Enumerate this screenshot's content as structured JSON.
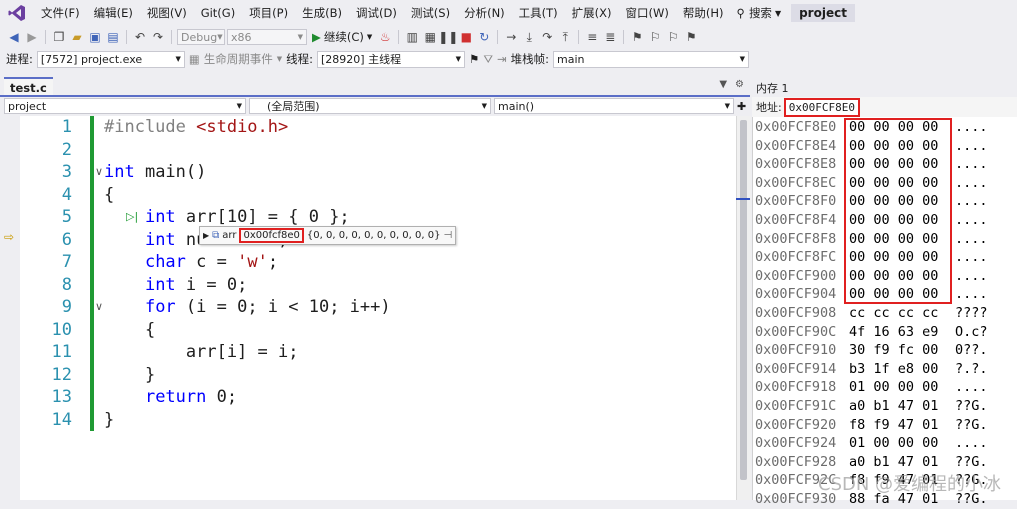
{
  "menubar": {
    "items": [
      "文件(F)",
      "编辑(E)",
      "视图(V)",
      "Git(G)",
      "项目(P)",
      "生成(B)",
      "调试(D)",
      "测试(S)",
      "分析(N)",
      "工具(T)",
      "扩展(X)",
      "窗口(W)",
      "帮助(H)"
    ],
    "search_label": "搜索",
    "title": "project"
  },
  "toolbar1": {
    "config": "Debug",
    "platform": "x86",
    "continue_label": "继续(C)"
  },
  "toolbar2": {
    "process_label": "进程:",
    "process_value": "[7572] project.exe",
    "lifecycle_label": "生命周期事件",
    "thread_label": "线程:",
    "thread_value": "[28920] 主线程",
    "stack_label": "堆栈帧:",
    "stack_value": "main"
  },
  "editor": {
    "tab_name": "test.c",
    "nav_project": "project",
    "nav_scope": "(全局范围)",
    "nav_function": "main()",
    "lines": [
      {
        "num": "1",
        "tokens": [
          {
            "t": "#include ",
            "c": "pp"
          },
          {
            "t": "<stdio.h>",
            "c": "str"
          }
        ]
      },
      {
        "num": "2",
        "tokens": []
      },
      {
        "num": "3",
        "tokens": [
          {
            "t": "int",
            "c": "kw"
          },
          {
            "t": " main()",
            "c": ""
          }
        ]
      },
      {
        "num": "4",
        "tokens": [
          {
            "t": "{",
            "c": ""
          }
        ]
      },
      {
        "num": "5",
        "tokens": [
          {
            "t": "    ",
            "c": ""
          },
          {
            "t": "int",
            "c": "kw"
          },
          {
            "t": " arr[10] = { 0 };",
            "c": ""
          }
        ]
      },
      {
        "num": "6",
        "tokens": [
          {
            "t": "    ",
            "c": ""
          },
          {
            "t": "int",
            "c": "kw"
          },
          {
            "t": " num = 100;",
            "c": ""
          }
        ]
      },
      {
        "num": "7",
        "tokens": [
          {
            "t": "    ",
            "c": ""
          },
          {
            "t": "char",
            "c": "kw"
          },
          {
            "t": " c = ",
            "c": ""
          },
          {
            "t": "'w'",
            "c": "str"
          },
          {
            "t": ";",
            "c": ""
          }
        ]
      },
      {
        "num": "8",
        "tokens": [
          {
            "t": "    ",
            "c": ""
          },
          {
            "t": "int",
            "c": "kw"
          },
          {
            "t": " i = 0;",
            "c": ""
          }
        ]
      },
      {
        "num": "9",
        "tokens": [
          {
            "t": "    ",
            "c": ""
          },
          {
            "t": "for",
            "c": "kw"
          },
          {
            "t": " (i = 0; i < 10; i++)",
            "c": ""
          }
        ]
      },
      {
        "num": "10",
        "tokens": [
          {
            "t": "    {",
            "c": ""
          }
        ]
      },
      {
        "num": "11",
        "tokens": [
          {
            "t": "        arr[i] = i;",
            "c": ""
          }
        ]
      },
      {
        "num": "12",
        "tokens": [
          {
            "t": "    }",
            "c": ""
          }
        ]
      },
      {
        "num": "13",
        "tokens": [
          {
            "t": "    ",
            "c": ""
          },
          {
            "t": "return",
            "c": "kw"
          },
          {
            "t": " 0;",
            "c": ""
          }
        ]
      },
      {
        "num": "14",
        "tokens": [
          {
            "t": "}",
            "c": ""
          }
        ]
      }
    ]
  },
  "datatip": {
    "name": "arr",
    "address": "0x00fcf8e0",
    "value": "{0, 0, 0, 0, 0, 0, 0, 0, 0, 0}"
  },
  "memory": {
    "title": "内存 1",
    "address_label": "地址:",
    "address_value": "0x00FCF8E0",
    "rows": [
      {
        "addr": "0x00FCF8E0",
        "bytes": "00 00 00 00",
        "ascii": "...."
      },
      {
        "addr": "0x00FCF8E4",
        "bytes": "00 00 00 00",
        "ascii": "...."
      },
      {
        "addr": "0x00FCF8E8",
        "bytes": "00 00 00 00",
        "ascii": "...."
      },
      {
        "addr": "0x00FCF8EC",
        "bytes": "00 00 00 00",
        "ascii": "...."
      },
      {
        "addr": "0x00FCF8F0",
        "bytes": "00 00 00 00",
        "ascii": "...."
      },
      {
        "addr": "0x00FCF8F4",
        "bytes": "00 00 00 00",
        "ascii": "...."
      },
      {
        "addr": "0x00FCF8F8",
        "bytes": "00 00 00 00",
        "ascii": "...."
      },
      {
        "addr": "0x00FCF8FC",
        "bytes": "00 00 00 00",
        "ascii": "...."
      },
      {
        "addr": "0x00FCF900",
        "bytes": "00 00 00 00",
        "ascii": "...."
      },
      {
        "addr": "0x00FCF904",
        "bytes": "00 00 00 00",
        "ascii": "...."
      },
      {
        "addr": "0x00FCF908",
        "bytes": "cc cc cc cc",
        "ascii": "????"
      },
      {
        "addr": "0x00FCF90C",
        "bytes": "4f 16 63 e9",
        "ascii": "O.c?"
      },
      {
        "addr": "0x00FCF910",
        "bytes": "30 f9 fc 00",
        "ascii": "0??."
      },
      {
        "addr": "0x00FCF914",
        "bytes": "b3 1f e8 00",
        "ascii": "?.?."
      },
      {
        "addr": "0x00FCF918",
        "bytes": "01 00 00 00",
        "ascii": "...."
      },
      {
        "addr": "0x00FCF91C",
        "bytes": "a0 b1 47 01",
        "ascii": "??G."
      },
      {
        "addr": "0x00FCF920",
        "bytes": "f8 f9 47 01",
        "ascii": "??G."
      },
      {
        "addr": "0x00FCF924",
        "bytes": "01 00 00 00",
        "ascii": "...."
      },
      {
        "addr": "0x00FCF928",
        "bytes": "a0 b1 47 01",
        "ascii": "??G."
      },
      {
        "addr": "0x00FCF92C",
        "bytes": "f8 f9 47 01",
        "ascii": "??G."
      },
      {
        "addr": "0x00FCF930",
        "bytes": "88 fa 47 01",
        "ascii": "??G."
      }
    ]
  },
  "watermark": "CSDN @爱编程的小冰",
  "colors": {
    "accent": "#5b6ec7",
    "highlight_box": "#e02020",
    "change_bar": "#1f9a33",
    "keyword": "#0000ff",
    "string": "#a31515",
    "line_number": "#2b91af"
  }
}
